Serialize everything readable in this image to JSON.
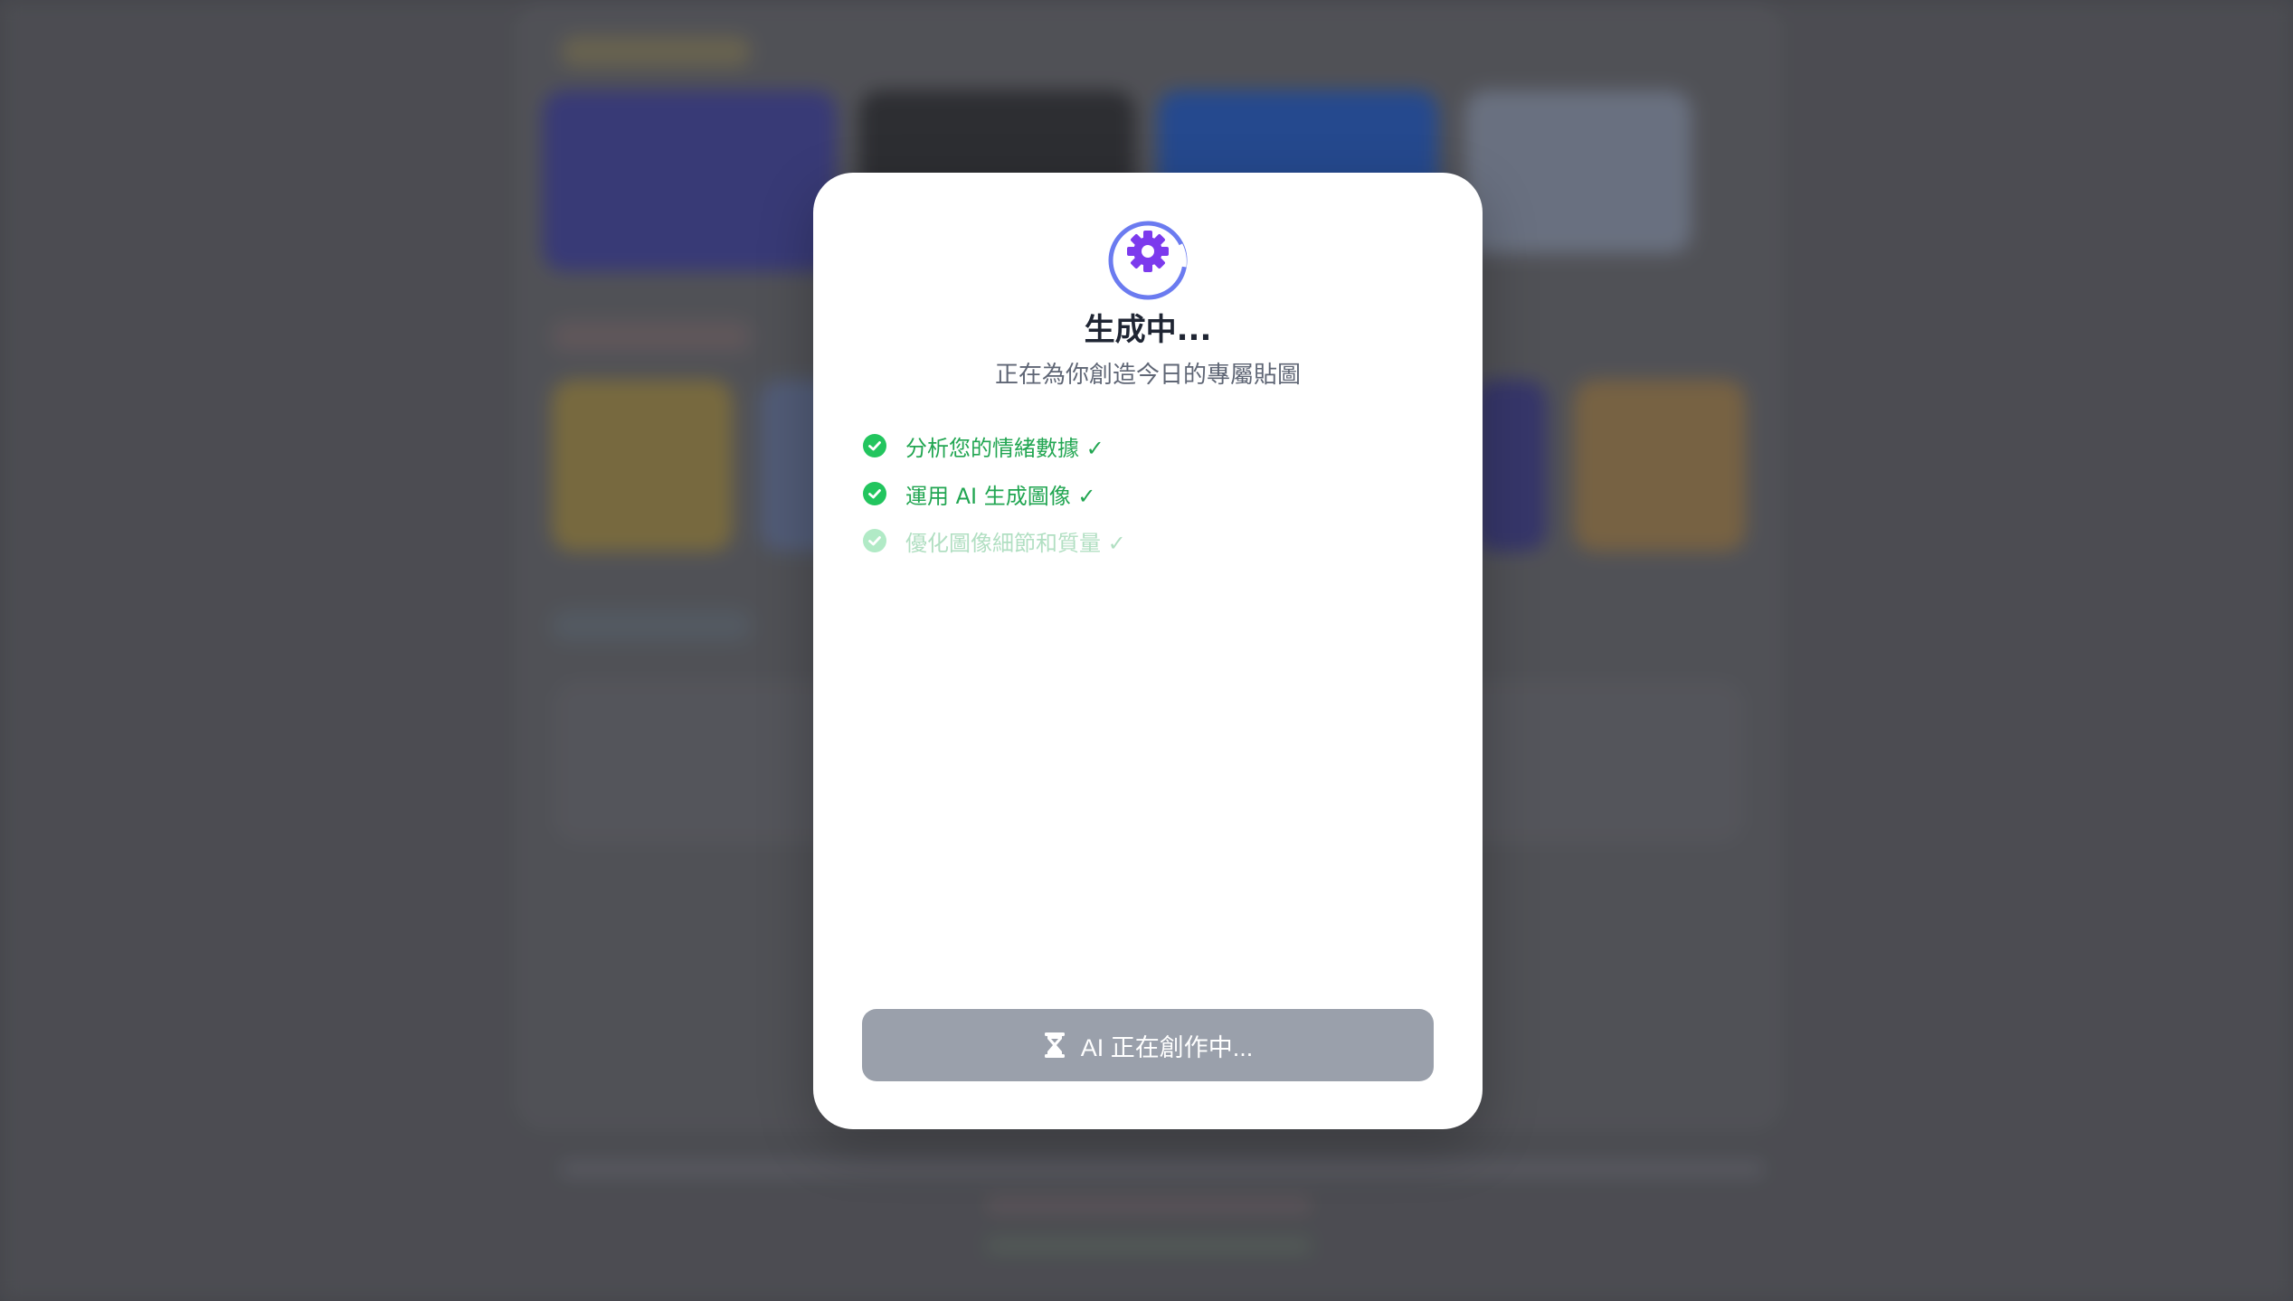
{
  "modal": {
    "title": "生成中...",
    "subtitle": "正在為你創造今日的專屬貼圖",
    "steps": [
      {
        "label": "分析您的情緒數據 ✓",
        "state": "done"
      },
      {
        "label": "運用 AI 生成圖像 ✓",
        "state": "done"
      },
      {
        "label": "優化圖像細節和質量 ✓",
        "state": "in-progress"
      }
    ],
    "status_button": {
      "label": "AI 正在創作中...",
      "icon": "hourglass-icon"
    }
  },
  "colors": {
    "accent_purple": "#7c3aed",
    "ring_indigo": "#6b7bf0",
    "success_green": "#22c55e",
    "button_gray": "#9aa0ab"
  }
}
